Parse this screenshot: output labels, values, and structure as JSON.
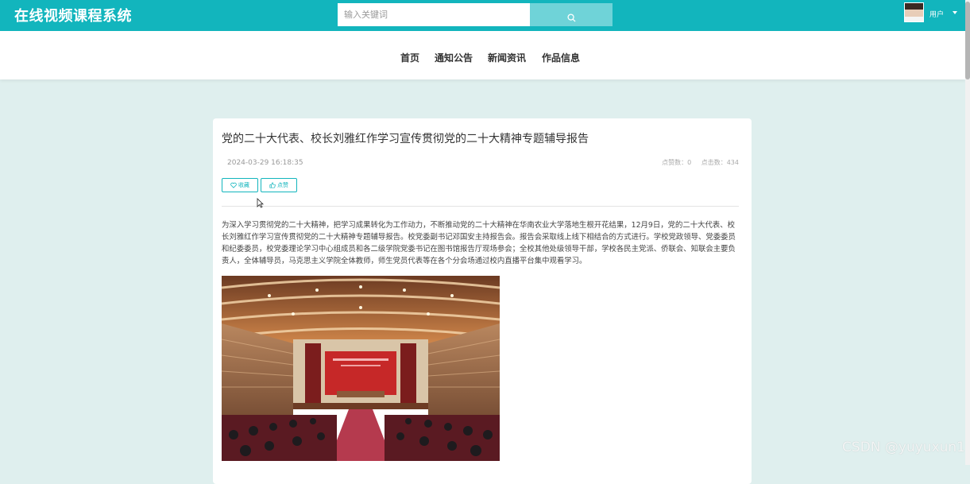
{
  "header": {
    "brand": "在线视频课程系统",
    "search_placeholder": "输入关键词",
    "user_label": "用户"
  },
  "nav": {
    "items": [
      {
        "label": "首页"
      },
      {
        "label": "通知公告"
      },
      {
        "label": "新闻资讯"
      },
      {
        "label": "作品信息"
      }
    ]
  },
  "article": {
    "title": "党的二十大代表、校长刘雅红作学习宣传贯彻党的二十大精神专题辅导报告",
    "date": "2024-03-29 16:18:35",
    "likes_label": "点赞数：0",
    "clicks_label": "点击数：434",
    "favorite_label": "收藏",
    "like_label": "点赞",
    "body": "为深入学习贯彻党的二十大精神，把学习成果转化为工作动力，不断推动党的二十大精神在华南农业大学落地生根开花结果，12月9日，党的二十大代表、校长刘雅红作学习宣传贯彻党的二十大精神专题辅导报告。校党委副书记邓国安主持报告会。报告会采取线上线下相结合的方式进行。学校党政领导、党委委员和纪委委员，校党委理论学习中心组成员和各二级学院党委书记在图书馆报告厅现场参会；全校其他处级领导干部，学校各民主党派、侨联会、知联会主要负责人，全体辅导员，马克思主义学院全体教师，师生党员代表等在各个分会场通过校内直播平台集中观看学习。"
  },
  "watermark": "CSDN @yuyuxun1",
  "colors": {
    "primary": "#12b5bd",
    "search_button": "#6fd3d8",
    "page_bg": "#dfefee"
  }
}
